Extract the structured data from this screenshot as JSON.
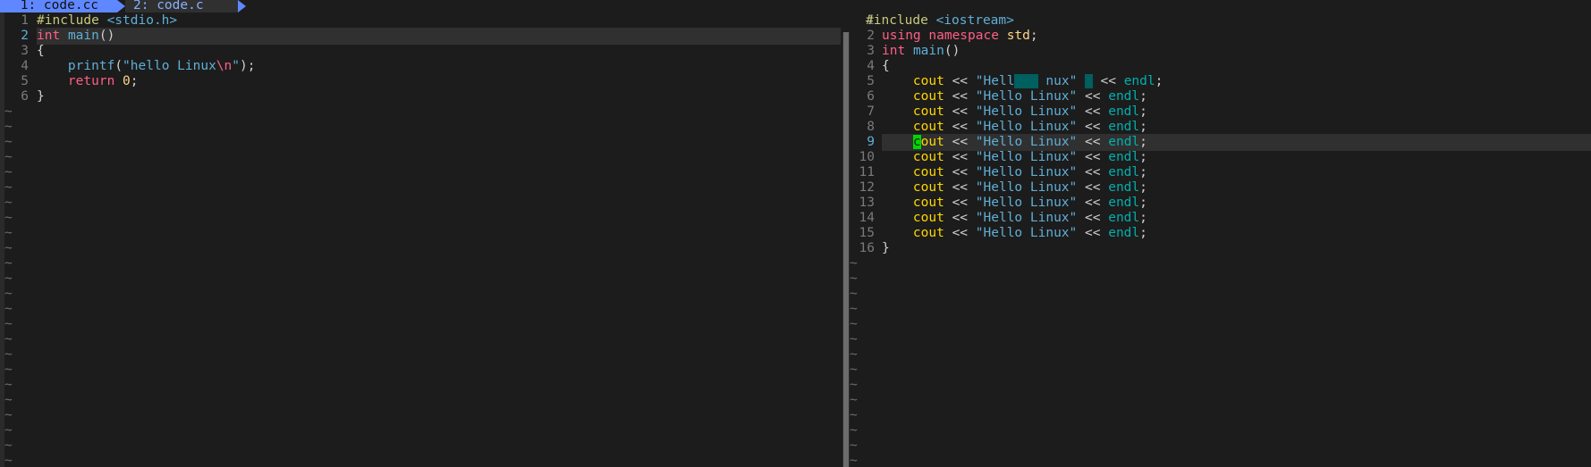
{
  "tabline": {
    "tabs": [
      {
        "label": " 1: code.cc ",
        "active": true
      },
      {
        "label": "2: code.c ",
        "active": false
      }
    ]
  },
  "left_pane": {
    "lines": [
      {
        "n": "1"
      },
      {
        "n": "2",
        "current": true
      },
      {
        "n": "3"
      },
      {
        "n": "4"
      },
      {
        "n": "5"
      },
      {
        "n": "6"
      }
    ],
    "code": {
      "l1_pre": "#include",
      "l1_inc": "<stdio.h>",
      "l2_type": "int",
      "l2_func": "main",
      "l2_paren": "()",
      "l3": "{",
      "l4_indent": "    ",
      "l4_func": "printf",
      "l4_open": "(",
      "l4_str_a": "\"hello Linux",
      "l4_esc": "\\n",
      "l4_str_b": "\"",
      "l4_close": ");",
      "l5_indent": "    ",
      "l5_kw": "return",
      "l5_num": "0",
      "l5_semi": ";",
      "l6": "}"
    },
    "tilde": "~"
  },
  "right_pane": {
    "lines": [
      {
        "n": "1"
      },
      {
        "n": "2"
      },
      {
        "n": "3"
      },
      {
        "n": "4"
      },
      {
        "n": "5"
      },
      {
        "n": "6"
      },
      {
        "n": "7"
      },
      {
        "n": "8"
      },
      {
        "n": "9",
        "current": true
      },
      {
        "n": "10"
      },
      {
        "n": "11"
      },
      {
        "n": "12"
      },
      {
        "n": "13"
      },
      {
        "n": "14"
      },
      {
        "n": "15"
      },
      {
        "n": "16"
      }
    ],
    "code": {
      "l1_pre": "#include",
      "l1_inc": "<iostream>",
      "l2_kw": "using",
      "l2_kw2": "namespace",
      "l2_ns": "std",
      "l2_semi": ";",
      "l3_type": "int",
      "l3_func": "main",
      "l3_paren": "()",
      "l4": "{",
      "indent": "    ",
      "cout": "cout",
      "cout_rest": "out",
      "cout_first": "c",
      "op": "<<",
      "str": "\"Hello Linux\"",
      "str_l5_a": "\"Hell",
      "str_l5_b": "nux\"",
      "endl": "endl",
      "semi": ";",
      "l16": "}"
    },
    "tilde": "~"
  },
  "colors": {
    "background": "#1c1c1c",
    "tab_active": "#5f87ff",
    "cursor": "#00d700",
    "cursorline": "#303030"
  }
}
